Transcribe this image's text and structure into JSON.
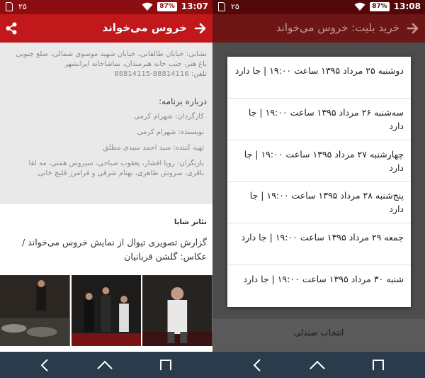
{
  "left": {
    "status": {
      "left_number": "۲۵",
      "battery": "87%",
      "time": "13:07"
    },
    "title": "خروس می‌خواند",
    "address": "نشانی: خیابان طالقانی، خیابان شهید موسوی شمالی، ضلع جنوبی باغ هنر، جنب خانه هنرمندان، تماشاخانه ایرانشهر",
    "phone": "تلفن: 88814116-88814115",
    "about_heading": "درباره برنامه:",
    "credits": [
      "کارگردان: شهرام کرمی",
      "نویسنده: شهرام کرمی",
      "تهیه کننده: سید احمد سیدی مطلق",
      "بازیگران: رویا افشار، یعقوب صباحی، سیروس همتی، مه لقا باقری، سروش طاهری، بهنام شرقی و فرامرز قلیچ خانی"
    ],
    "theater_name": "تئاتر شایا",
    "report_title": "گزارش تصویری تیوال از نمایش خروس می‌خواند / عکاس: گلشن قربانیان"
  },
  "right": {
    "status": {
      "left_number": "۲۵",
      "battery": "87%",
      "time": "13:08"
    },
    "title": "خرید بلیت: خروس می‌خواند",
    "options": [
      "دوشنبه ۲۵ مرداد ۱۳۹۵ ساعت ۱۹:۰۰ | جا دارد",
      "سه‌شنبه ۲۶ مرداد ۱۳۹۵ ساعت ۱۹:۰۰ | جا دارد",
      "چهارشنبه ۲۷ مرداد ۱۳۹۵ ساعت ۱۹:۰۰ | جا دارد",
      "پنج‌شنبه ۲۸ مرداد ۱۳۹۵ ساعت ۱۹:۰۰ | جا دارد",
      "جمعه ۲۹ مرداد ۱۳۹۵ ساعت ۱۹:۰۰ | جا دارد",
      "شنبه ۳۰ مرداد ۱۳۹۵ ساعت ۱۹:۰۰ | جا دارد"
    ],
    "select_seat": "انتخاب صندلی"
  },
  "colors": {
    "primary": "#c0181b",
    "primary_dark": "#8c0e10",
    "navbar": "#2a3b4b"
  },
  "icons": [
    "sim-icon",
    "wifi-icon",
    "battery-icon",
    "share-icon",
    "back-arrow-icon",
    "nav-back-icon",
    "nav-home-icon",
    "nav-recent-icon"
  ]
}
